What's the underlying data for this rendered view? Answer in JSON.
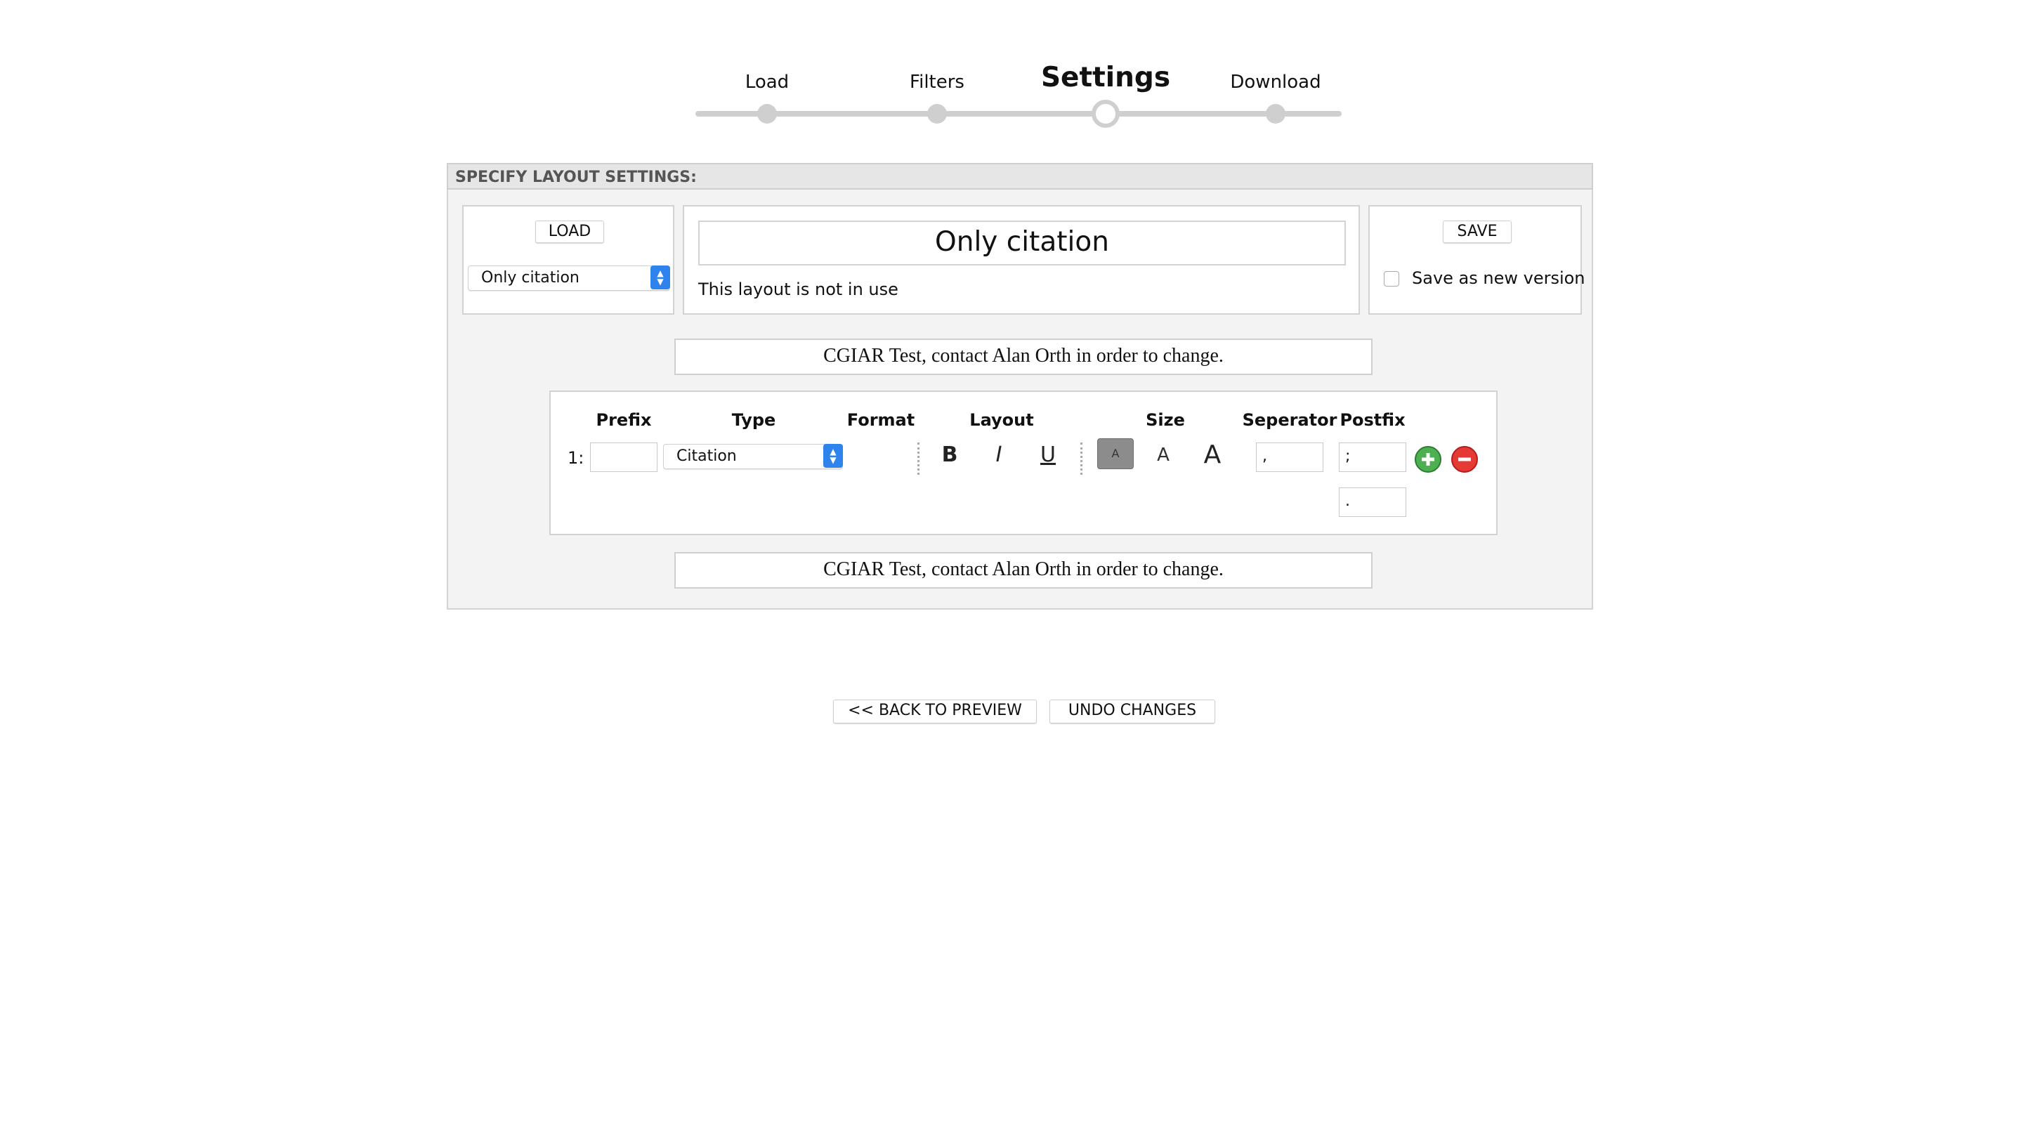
{
  "stepper": {
    "steps": [
      {
        "label": "Load",
        "state": "done"
      },
      {
        "label": "Filters",
        "state": "done"
      },
      {
        "label": "Settings",
        "state": "active"
      },
      {
        "label": "Download",
        "state": "todo"
      }
    ]
  },
  "panel": {
    "header": "SPECIFY LAYOUT SETTINGS:",
    "load": {
      "button_label": "LOAD",
      "selected_layout": "Only citation"
    },
    "layout": {
      "name": "Only citation",
      "status_text": "This layout is not in use"
    },
    "save": {
      "button_label": "SAVE",
      "checkbox_label": "Save as new version",
      "checked": false
    },
    "notice_top": "CGIAR Test, contact Alan Orth in order to change.",
    "notice_bottom": "CGIAR Test, contact Alan Orth in order to change.",
    "table": {
      "headers": {
        "prefix": "Prefix",
        "type": "Type",
        "format": "Format",
        "layout": "Layout",
        "size": "Size",
        "separator": "Seperator",
        "postfix": "Postfix"
      },
      "rows": [
        {
          "index": "1:",
          "prefix": "",
          "type": "Citation",
          "format_buttons": {
            "bold": "B",
            "italic": "I",
            "underline": "U"
          },
          "size_buttons": {
            "small": "A",
            "medium": "A",
            "large": "A"
          },
          "selected_size": "small",
          "separator": ",",
          "postfix": ";",
          "postfix_extra": "."
        }
      ]
    }
  },
  "footer": {
    "back_label": "<< BACK TO PREVIEW",
    "undo_label": "UNDO CHANGES"
  },
  "colors": {
    "active_dot_border": "#cfcfcf",
    "select_arrow_bg": "#2f83ec",
    "add_button": "#4caf50",
    "remove_button": "#e53935",
    "size_selected_bg": "#8c8c8c"
  },
  "icons": {
    "add": "plus-circle-icon",
    "remove": "minus-circle-icon",
    "select_arrows": "up-down-arrows-icon"
  }
}
